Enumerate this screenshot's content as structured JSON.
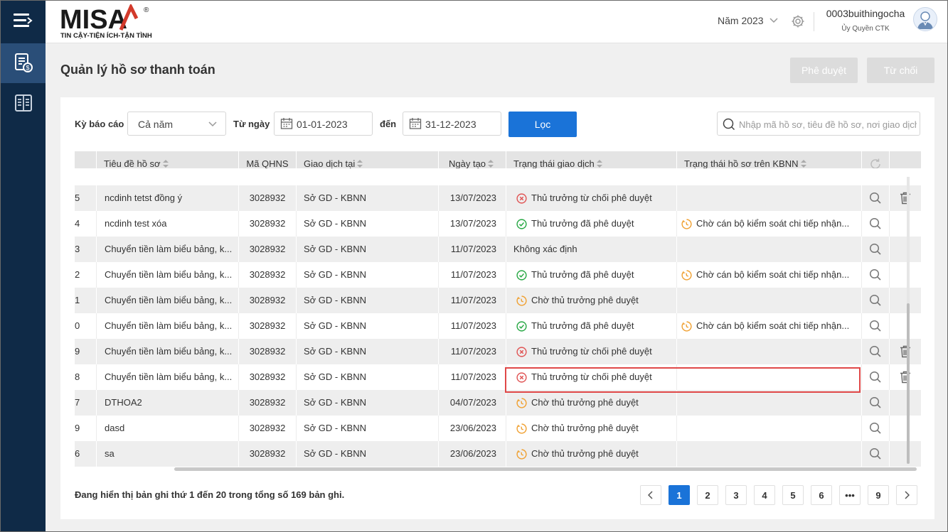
{
  "header": {
    "logo_text": "MISA",
    "logo_tagline": "TIN CẬY-TIỆN ÍCH-TẬN TÌNH",
    "year_label": "Năm 2023",
    "username": "0003buithingocha",
    "user_role": "Ủy Quyền CTK"
  },
  "page": {
    "title": "Quản lý hồ sơ thanh toán",
    "approve_label": "Phê duyệt",
    "reject_label": "Từ chối"
  },
  "filters": {
    "period_label": "Kỳ báo cáo",
    "period_value": "Cả năm",
    "from_label": "Từ ngày",
    "from_value": "01-01-2023",
    "to_label": "đến",
    "to_value": "31-12-2023",
    "filter_button": "Lọc",
    "search_placeholder": "Nhập mã hồ sơ, tiêu đề hồ sơ, nơi giao dịch"
  },
  "table": {
    "columns": [
      "Tiêu đề hồ sơ",
      "Mã QHNS",
      "Giao dịch tại",
      "Ngày tạo",
      "Trạng thái giao dịch",
      "Trạng thái hồ sơ trên KBNN"
    ],
    "rows": [
      {
        "no": "5",
        "title": "ncdinh tetst đồng ý",
        "code": "3028932",
        "place": "Sở GD - KBNN",
        "date": "13/07/2023",
        "status": "Thủ trưởng từ chối phê duyệt",
        "status_type": "rejected",
        "kbnn": "",
        "deletable": true
      },
      {
        "no": "4",
        "title": "ncdinh test xóa",
        "code": "3028932",
        "place": "Sở GD - KBNN",
        "date": "13/07/2023",
        "status": "Thủ trưởng đã phê duyệt",
        "status_type": "approved",
        "kbnn": "Chờ cán bộ kiểm soát chi tiếp nhận...",
        "deletable": false
      },
      {
        "no": "3",
        "title": "Chuyển tiền làm biểu bảng, k...",
        "code": "3028932",
        "place": "Sở GD - KBNN",
        "date": "11/07/2023",
        "status": "Không xác định",
        "status_type": "none",
        "kbnn": "",
        "deletable": false
      },
      {
        "no": "2",
        "title": "Chuyển tiền làm biểu bảng, k...",
        "code": "3028932",
        "place": "Sở GD - KBNN",
        "date": "11/07/2023",
        "status": "Thủ trưởng đã phê duyệt",
        "status_type": "approved",
        "kbnn": "Chờ cán bộ kiểm soát chi tiếp nhận...",
        "deletable": false
      },
      {
        "no": "1",
        "title": "Chuyển tiền làm biểu bảng, k...",
        "code": "3028932",
        "place": "Sở GD - KBNN",
        "date": "11/07/2023",
        "status": "Chờ thủ trưởng phê duyệt",
        "status_type": "pending",
        "kbnn": "",
        "deletable": false
      },
      {
        "no": "0",
        "title": "Chuyển tiền làm biểu bảng, k...",
        "code": "3028932",
        "place": "Sở GD - KBNN",
        "date": "11/07/2023",
        "status": "Thủ trưởng đã phê duyệt",
        "status_type": "approved",
        "kbnn": "Chờ cán bộ kiểm soát chi tiếp nhận...",
        "deletable": false
      },
      {
        "no": "9",
        "title": "Chuyển tiền làm biểu bảng, k...",
        "code": "3028932",
        "place": "Sở GD - KBNN",
        "date": "11/07/2023",
        "status": "Thủ trưởng từ chối phê duyệt",
        "status_type": "rejected",
        "kbnn": "",
        "deletable": true
      },
      {
        "no": "8",
        "title": "Chuyển tiền làm biểu bảng, k...",
        "code": "3028932",
        "place": "Sở GD - KBNN",
        "date": "11/07/2023",
        "status": "Thủ trưởng từ chối phê duyệt",
        "status_type": "rejected",
        "kbnn": "",
        "deletable": true
      },
      {
        "no": "7",
        "title": "DTHOA2",
        "code": "3028932",
        "place": "Sở GD - KBNN",
        "date": "04/07/2023",
        "status": "Chờ thủ trưởng phê duyệt",
        "status_type": "pending",
        "kbnn": "",
        "deletable": false
      },
      {
        "no": "9",
        "title": "dasd",
        "code": "3028932",
        "place": "Sở GD - KBNN",
        "date": "23/06/2023",
        "status": "Chờ thủ trưởng phê duyệt",
        "status_type": "pending",
        "kbnn": "",
        "deletable": false
      },
      {
        "no": "6",
        "title": "sa",
        "code": "3028932",
        "place": "Sở GD - KBNN",
        "date": "23/06/2023",
        "status": "Chờ thủ trưởng phê duyệt",
        "status_type": "pending",
        "kbnn": "",
        "deletable": false
      }
    ]
  },
  "footer": {
    "summary": "Đang hiển thị bản ghi thứ 1 đến 20 trong tổng số 169 bản ghi.",
    "pages": [
      "1",
      "2",
      "3",
      "4",
      "5",
      "6",
      "•••",
      "9"
    ],
    "active_page": "1"
  },
  "colors": {
    "nav_bg": "#0f2a47",
    "accent": "#1a73d8",
    "approved": "#27a844",
    "rejected": "#e05454",
    "pending": "#f0a030",
    "highlight": "#e04848"
  }
}
